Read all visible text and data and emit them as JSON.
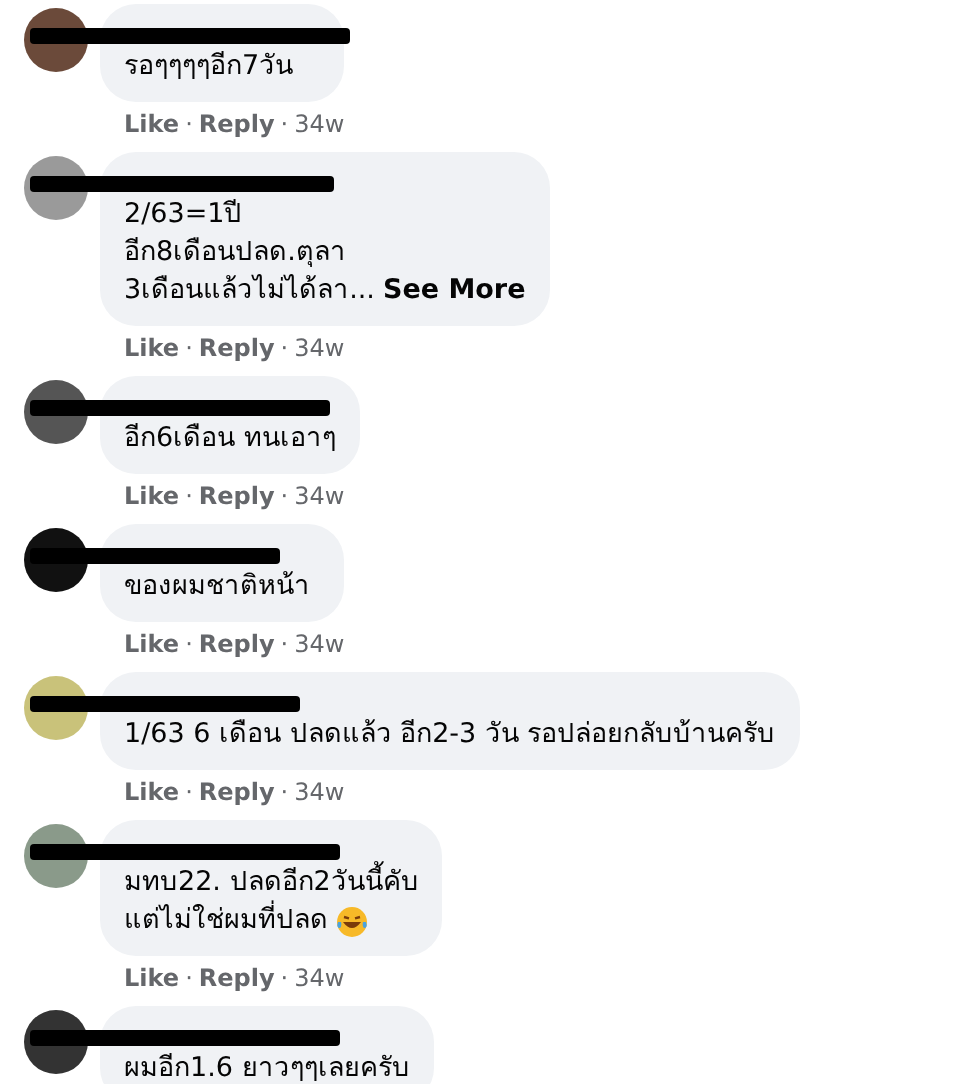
{
  "comments": [
    {
      "lines": [
        {
          "text": "รอๆๆๆๆอีก7วัน"
        }
      ],
      "actions": {
        "like": "Like",
        "separator": "·",
        "reply": "Reply",
        "time": "34w"
      }
    },
    {
      "lines": [
        {
          "text": "2/63=1ปี"
        },
        {
          "text": "อีก8เดือนปลด.ตุลา"
        },
        {
          "text": "3เดือนแล้วไม่ได้ลา...",
          "more": "See More"
        }
      ],
      "actions": {
        "like": "Like",
        "separator": "·",
        "reply": "Reply",
        "time": "34w"
      }
    },
    {
      "lines": [
        {
          "text": "อีก6เดือน ทนเอาๆ"
        }
      ],
      "actions": {
        "like": "Like",
        "separator": "·",
        "reply": "Reply",
        "time": "34w"
      }
    },
    {
      "lines": [
        {
          "text": "ของผมชาติหน้า"
        }
      ],
      "actions": {
        "like": "Like",
        "separator": "·",
        "reply": "Reply",
        "time": "34w"
      }
    },
    {
      "lines": [
        {
          "text": "1/63 6 เดือน ปลดแล้ว อีก2-3 วัน รอปล่อยกลับบ้านครับ"
        }
      ],
      "actions": {
        "like": "Like",
        "separator": "·",
        "reply": "Reply",
        "time": "34w"
      }
    },
    {
      "lines": [
        {
          "text": "มทบ22. ปลดอีก2วันนี้คับ"
        },
        {
          "text": "แต่ไม่ใช่ผมที่ปลด",
          "emoji": true
        }
      ],
      "actions": {
        "like": "Like",
        "separator": "·",
        "reply": "Reply",
        "time": "34w"
      }
    },
    {
      "lines": [
        {
          "text": "ผมอีก1.6 ยาวๆๆเลยครับ"
        }
      ]
    }
  ]
}
